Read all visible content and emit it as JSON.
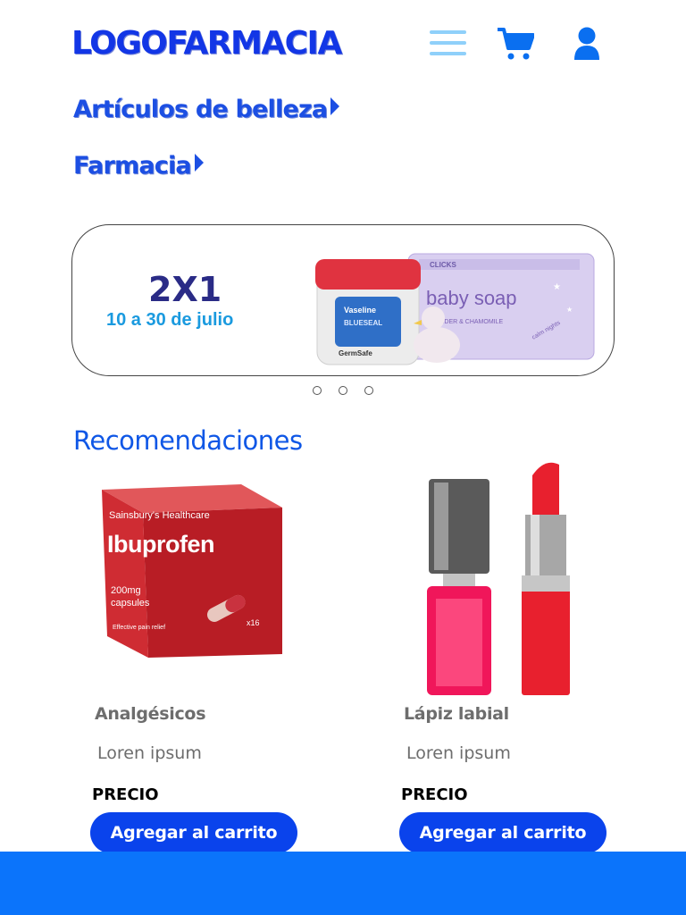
{
  "header": {
    "logo": "LOGOFARMACIA",
    "icons": [
      "menu-icon",
      "cart-icon",
      "user-icon"
    ],
    "brand_color": "#1236e6"
  },
  "categories": [
    {
      "label": "Artículos de belleza"
    },
    {
      "label": "Farmacia"
    }
  ],
  "banner": {
    "title": "2X1",
    "dates": "10 a 30 de julio",
    "image_text": {
      "jar_brand": "Vaseline",
      "jar_product": "BLUESEAL",
      "jar_line": "GermSafe",
      "soap_brand": "CLICKS",
      "soap_product": "baby soap",
      "soap_variant": "LAVENDER & CHAMOMILE",
      "soap_tag": "calm nights"
    },
    "slides_count": 3
  },
  "recommendations": {
    "title": "Recomendaciones",
    "products": [
      {
        "name": "Analgésicos",
        "description": "Loren ipsum",
        "price_label": "PRECIO",
        "button_label": "Agregar al carrito",
        "image_text": {
          "brand": "Sainsbury's Healthcare",
          "product": "Ibuprofen",
          "dose": "200mg",
          "form": "capsules",
          "count": "x16",
          "claim": "Effective pain relief"
        }
      },
      {
        "name": "Lápiz labial",
        "description": "Loren ipsum",
        "price_label": "PRECIO",
        "button_label": "Agregar al carrito"
      }
    ]
  },
  "colors": {
    "accent": "#0a43ec",
    "footer": "#0b74fb",
    "section_title": "#0f57e6"
  }
}
